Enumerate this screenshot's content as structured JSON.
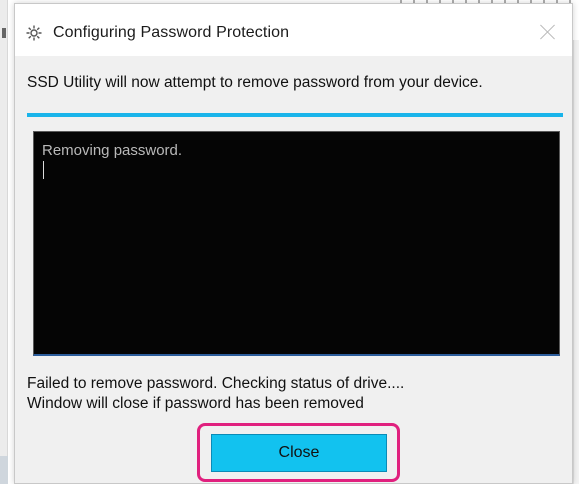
{
  "dialog": {
    "title": "Configuring Password Protection",
    "title_icon": "gear-icon",
    "close_icon": "close-icon",
    "message": "SSD Utility will now attempt to remove password from your device.",
    "progress": 1.0,
    "console": {
      "line": "Removing password."
    },
    "status_line_1": "Failed to remove password. Checking status of drive....",
    "status_line_2": "Window will close if password has been removed",
    "close_button": "Close"
  },
  "colors": {
    "accent": "#19b4ea",
    "button": "#12c2ef",
    "highlight": "#e0207e",
    "console_bg": "#050505"
  }
}
